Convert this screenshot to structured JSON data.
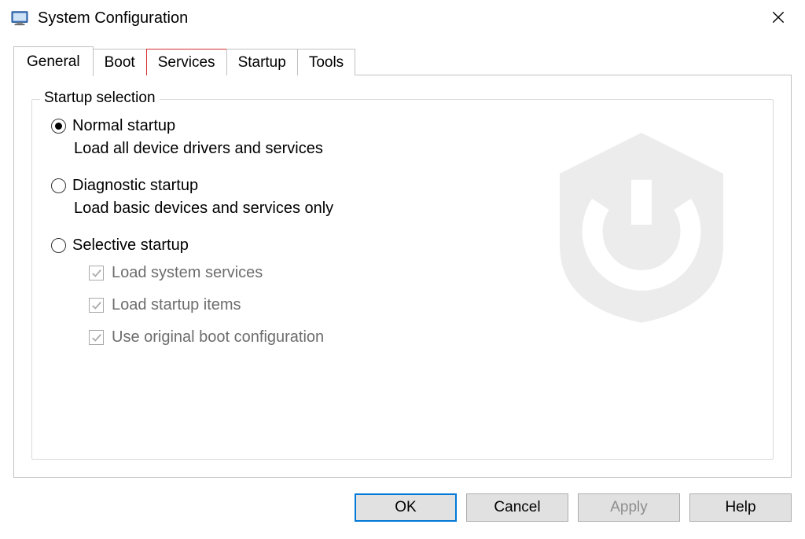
{
  "window": {
    "title": "System Configuration",
    "close_icon": "close-icon"
  },
  "tabs": [
    {
      "label": "General",
      "active": true,
      "highlight": false
    },
    {
      "label": "Boot",
      "active": false,
      "highlight": false
    },
    {
      "label": "Services",
      "active": false,
      "highlight": true
    },
    {
      "label": "Startup",
      "active": false,
      "highlight": false
    },
    {
      "label": "Tools",
      "active": false,
      "highlight": false
    }
  ],
  "group": {
    "title": "Startup selection",
    "options": [
      {
        "label": "Normal startup",
        "desc": "Load all device drivers and services",
        "selected": true
      },
      {
        "label": "Diagnostic startup",
        "desc": "Load basic devices and services only",
        "selected": false
      },
      {
        "label": "Selective startup",
        "desc": "",
        "selected": false
      }
    ],
    "selective_checks": [
      {
        "label": "Load system services",
        "checked": true,
        "enabled": false
      },
      {
        "label": "Load startup items",
        "checked": true,
        "enabled": false
      },
      {
        "label": "Use original boot configuration",
        "checked": true,
        "enabled": false
      }
    ]
  },
  "buttons": {
    "ok": "OK",
    "cancel": "Cancel",
    "apply": "Apply",
    "help": "Help"
  }
}
